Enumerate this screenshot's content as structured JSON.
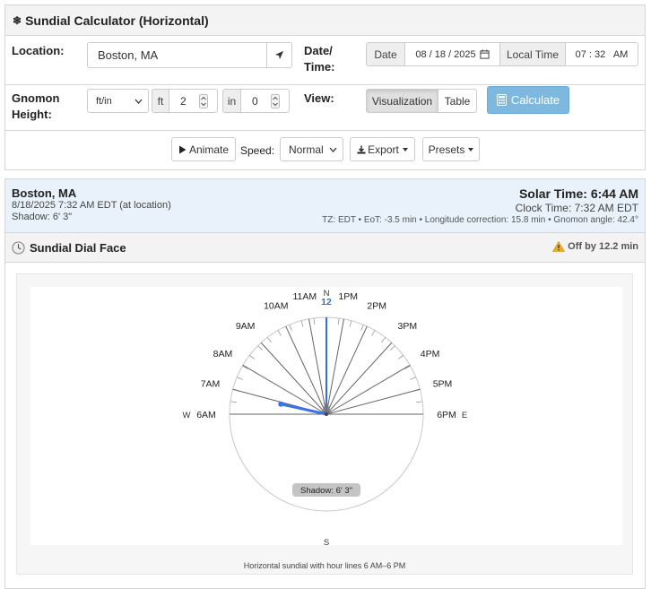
{
  "app": {
    "title": "Sundial Calculator (Horizontal)"
  },
  "form": {
    "location_label": "Location:",
    "location_value": "Boston, MA",
    "datetime_label_1": "Date/",
    "datetime_label_2": "Time:",
    "date_addon": "Date",
    "date_value": "08 / 18 / 2025",
    "time_addon": "Local Time",
    "time_value": "07 : 32   AM",
    "gnomon_label_1": "Gnomon",
    "gnomon_label_2": "Height:",
    "unit_select": "ft/in",
    "ft_addon": "ft",
    "ft_value": "2",
    "in_addon": "in",
    "in_value": "0",
    "view_label": "View:",
    "view_options": [
      "Visualization",
      "Table"
    ],
    "calculate_label": "Calculate",
    "animate_label": "Animate",
    "speed_label": "Speed:",
    "speed_value": "Normal",
    "export_label": "Export",
    "presets_label": "Presets"
  },
  "summary": {
    "location": "Boston, MA",
    "datetime": "8/18/2025 7:32 AM EDT (at location)",
    "shadow": "Shadow: 6' 3\"",
    "solar_time": "Solar Time: 6:44 AM",
    "clock_time": "Clock Time: 7:32 AM EDT",
    "details": "TZ: EDT • EoT: -3.5 min • Longitude correction: 15.8 min • Gnomon angle: 42.4°"
  },
  "dial": {
    "title": "Sundial Dial Face",
    "warning": "Off by 12.2 min",
    "compass": {
      "n": "N",
      "s": "S",
      "e": "E",
      "w": "W"
    },
    "noon_label": "12",
    "hour_labels": [
      "6AM",
      "7AM",
      "8AM",
      "9AM",
      "10AM",
      "11AM",
      "1PM",
      "2PM",
      "3PM",
      "4PM",
      "5PM",
      "6PM"
    ],
    "hour_line_angles_deg": [
      -90,
      -75.1,
      -59.6,
      -42.4,
      -24.8,
      -10.4,
      10.4,
      24.8,
      42.4,
      59.6,
      75.1,
      90
    ],
    "shadow_angle_deg": -77.5,
    "shadow_badge": "Shadow: 6' 3\"",
    "caption": "Horizontal sundial with hour lines 6 AM–6 PM",
    "colors": {
      "noon_line": "#2f6fdb",
      "shadow": "#3b73e6",
      "hour_line": "#666666"
    }
  },
  "icons": {
    "header": "snowflake-icon",
    "locate": "location-arrow-icon",
    "date": "calendar-icon",
    "calc": "calculator-icon",
    "animate": "play-icon",
    "export": "download-icon",
    "dial": "clock-icon",
    "warning": "warning-icon"
  }
}
